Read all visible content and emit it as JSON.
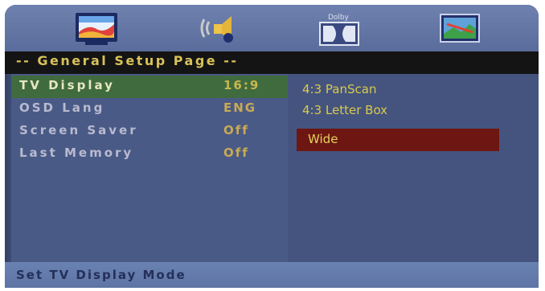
{
  "icons": [
    "general-setup-icon",
    "audio-setup-icon",
    "dolby-digital-icon",
    "preference-icon"
  ],
  "dolby_label": "Dolby",
  "page_title": "-- General Setup Page --",
  "menu": [
    {
      "label": "TV Display",
      "value": "16:9"
    },
    {
      "label": "OSD Lang",
      "value": "ENG"
    },
    {
      "label": "Screen Saver",
      "value": "Off"
    },
    {
      "label": "Last Memory",
      "value": "Off"
    }
  ],
  "options": [
    "4:3 PanScan",
    "4:3 Letter Box",
    "Wide"
  ],
  "status": "Set TV Display Mode"
}
